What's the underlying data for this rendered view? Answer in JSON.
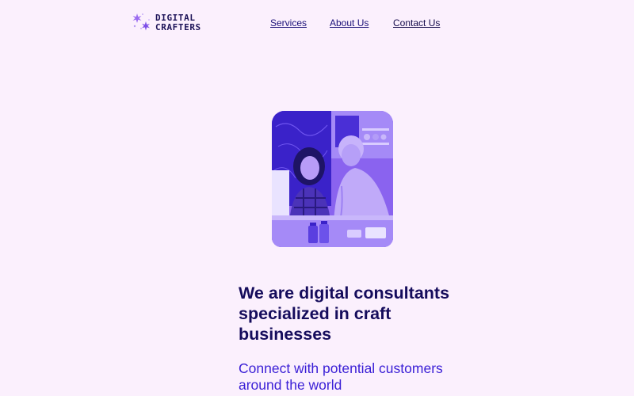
{
  "brand": {
    "line1": "DIGITAL",
    "line2": "CRAFTERS",
    "logo_icon": "sparkle-cluster-icon"
  },
  "nav": {
    "items": [
      {
        "label": "Services"
      },
      {
        "label": "About Us"
      },
      {
        "label": "Contact Us"
      }
    ]
  },
  "hero": {
    "image": "two-people-working-at-computer",
    "headline": "We are digital consultants specialized in craft businesses",
    "subheadline": "Connect with potential customers around the world"
  },
  "colors": {
    "background": "#fbf0fd",
    "accent": "#3a1fd6",
    "text_dark": "#150c5c",
    "logo_purple": "#8b5cf6"
  }
}
